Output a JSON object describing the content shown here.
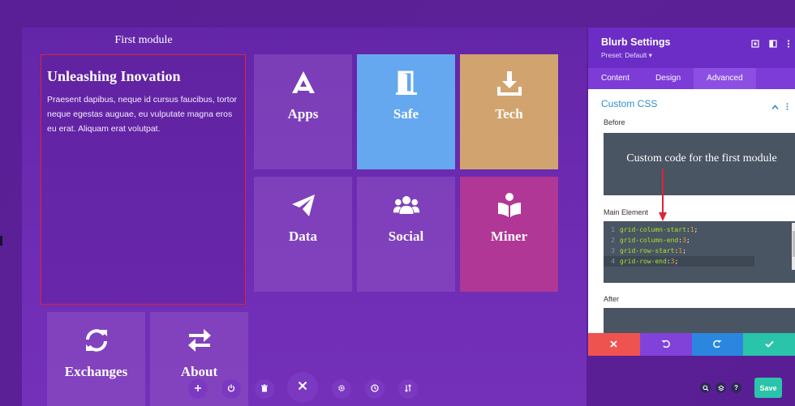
{
  "builder": {
    "first_module_label": "First module",
    "text_module": {
      "heading": "Unleashing Inovation",
      "body": "Praesent dapibus, neque id cursus faucibus, tortor neque egestas auguae, eu vulputate magna eros eu erat. Aliquam erat volutpat."
    },
    "tiles": [
      {
        "label": "Apps",
        "icon": "apps-logo-icon",
        "color": "purple"
      },
      {
        "label": "Safe",
        "icon": "door-icon",
        "color": "#65a8ef"
      },
      {
        "label": "Tech",
        "icon": "download-icon",
        "color": "#d1a46f"
      },
      {
        "label": "Data",
        "icon": "paper-plane-icon",
        "color": "purple"
      },
      {
        "label": "Social",
        "icon": "users-icon",
        "color": "purple"
      },
      {
        "label": "Miner",
        "icon": "reader-icon",
        "color": "#b03795"
      },
      {
        "label": "Exchanges",
        "icon": "sync-icon",
        "color": "purple"
      },
      {
        "label": "About",
        "icon": "exchange-icon",
        "color": "purple"
      }
    ],
    "toolbar": [
      "add-icon",
      "power-icon",
      "trash-icon",
      "close-icon",
      "gear-icon",
      "history-icon",
      "sort-icon"
    ]
  },
  "panel": {
    "title": "Blurb Settings",
    "preset": "Preset: Default ▾",
    "tabs": [
      {
        "label": "Content",
        "active": false
      },
      {
        "label": "Design",
        "active": false
      },
      {
        "label": "Advanced",
        "active": true
      }
    ],
    "section_title": "Custom CSS",
    "before_label": "Before",
    "before_annotation": "Custom code for the first module",
    "main_label": "Main Element",
    "code_lines": [
      {
        "n": "1",
        "prop": "grid-column-start",
        "val": "1"
      },
      {
        "n": "2",
        "prop": "grid-column-end",
        "val": "3"
      },
      {
        "n": "3",
        "prop": "grid-row-start",
        "val": "1"
      },
      {
        "n": "4",
        "prop": "grid-row-end",
        "val": "3"
      }
    ],
    "after_label": "After",
    "action_colors": {
      "cancel": "#ef5350",
      "undo": "#8142d9",
      "redo": "#2b86e0",
      "confirm": "#29c4a9"
    }
  },
  "footer": {
    "save_label": "Save",
    "help_label": "?"
  },
  "colors": {
    "accent": "#6b2dc5",
    "highlight_border": "#e0213a",
    "arrow": "#e0213a"
  }
}
